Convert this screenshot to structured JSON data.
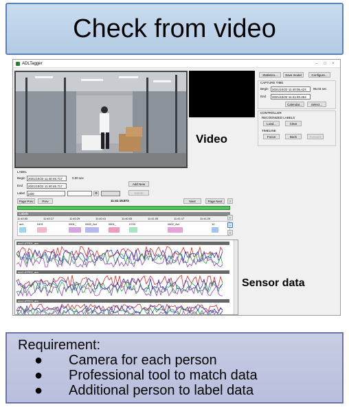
{
  "slide": {
    "title": "Check from video",
    "video_label": "Video",
    "sensor_label": "Sensor data",
    "requirement": {
      "title": "Requirement:",
      "items": [
        "Camera for each person",
        "Professional tool to match data",
        "Additional person to label data"
      ]
    }
  },
  "app": {
    "window_title": "ADLTagger",
    "controls": {
      "minimize": "–",
      "maximize": "□",
      "close": "×"
    },
    "top_buttons": {
      "statistics": "Statistics...",
      "save_model": "Save model",
      "configure": "Configure..."
    },
    "capture_time": {
      "title": "CAPTURE TIME",
      "begin_label": "Begin",
      "begin_value": "2021/10/22 11:40:05.424",
      "duration": "95.03 sec",
      "end_label": "End",
      "end_value": "2021/10/22 11:41:40.454",
      "calendar_button": "Calendar...",
      "select_button": "Select..."
    },
    "controller": {
      "title": "CONTROLLER",
      "recognized_title": "RECOGNIZED LABELS",
      "load_button": "Load...",
      "clear_button": "Clear",
      "timeline_title": "TIMELINE",
      "focus_button": "Focus",
      "back_button": "Back",
      "forward_button": "Forward"
    },
    "label_panel": {
      "title": "LABEL",
      "begin_label": "Begin",
      "begin_value": "2021/10/22 11:40:45.717",
      "duration": "0.00 sec",
      "end_label": "End",
      "end_value": "2021/10/22 11:40:45.717",
      "label_label": "Label",
      "label_value": "job0",
      "add_new_button": "Add New",
      "delete_button": "Delete"
    },
    "nav": {
      "page_prev": "Page Prev",
      "prev": "Prev",
      "current_time": "11:41:15.873",
      "next": "Next",
      "page_next": "Page Next"
    },
    "labels_strip": "Labels",
    "ticks": [
      "11:40:05",
      "11:40:17",
      "11:40:29",
      "11:40:41",
      "11:40:53",
      "11:41:05",
      "11:41:17",
      "11:41:29"
    ],
    "label_blocks": [
      {
        "text": "ach",
        "color": "#9fd5ef"
      },
      {
        "text": "0401",
        "color": "#f0b9c9"
      },
      {
        "text": "0501_",
        "color": "#d6a4e0"
      },
      {
        "text": "0502_Act",
        "color": "#b7b7f2"
      },
      {
        "text": "0601_",
        "color": "#ef9bbf"
      },
      {
        "text": "0703",
        "color": "#a6e6c0"
      },
      {
        "text": "0802_Act",
        "color": "#e7a3d9"
      },
      {
        "text": "10",
        "color": "#9fc4f2"
      }
    ],
    "sensors": [
      "acc2.ATR01_acc",
      "acc2.ATR02_acc",
      "acc2.ATR03_acc"
    ],
    "colors": {
      "timeline": "#55c35a",
      "series": [
        "#e02020",
        "#2030d0",
        "#20a040",
        "#9040c0"
      ]
    }
  }
}
